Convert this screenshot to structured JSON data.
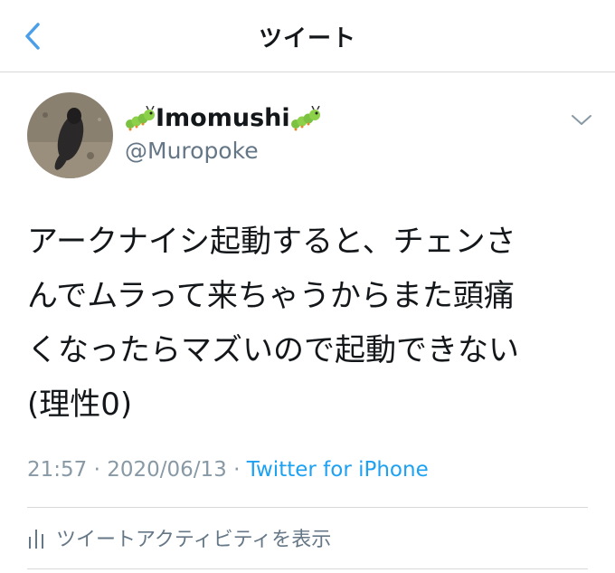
{
  "header": {
    "back_icon": "chevron-left-icon",
    "title": "ツイート"
  },
  "tweet": {
    "display_name": "Imomushi",
    "name_emoji": "caterpillar",
    "handle": "@Muropoke",
    "text": "アークナイシ起動すると、チェンさ\nんでムラって来ちゃうからまた頭痛\nくなったらマズいので起動できない\n(理性0)",
    "time": "21:57",
    "separator": "·",
    "date": "2020/06/13",
    "source": "Twitter for iPhone"
  },
  "activity": {
    "icon": "bar-chart-icon",
    "label": "ツイートアクティビティを表示"
  },
  "colors": {
    "accent": "#1da1f2",
    "back_arrow": "#4a9fe8",
    "secondary_text": "#8899a6",
    "divider": "#d6d8da"
  }
}
